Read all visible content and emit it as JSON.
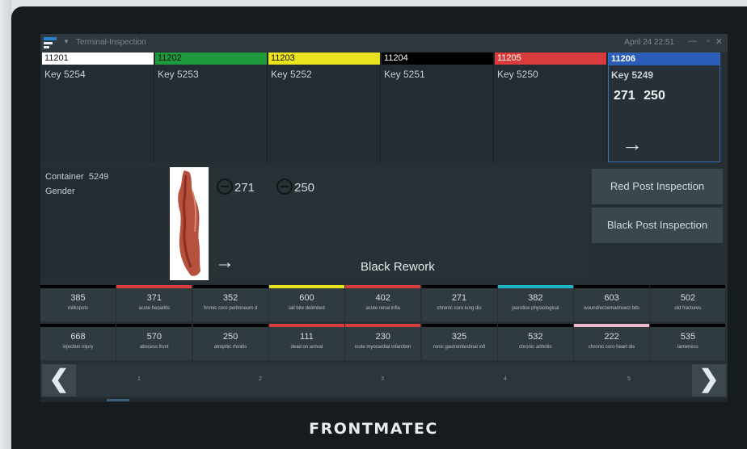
{
  "window": {
    "title": "Terminal-Inspection",
    "datetime": "April 24 22:51",
    "minimize": "—",
    "restore": "▫",
    "close": "✕"
  },
  "tiles": [
    {
      "id": "11201",
      "color": "#ffffff",
      "text_color": "#111111",
      "key": "Key 5254"
    },
    {
      "id": "11202",
      "color": "#1e9a3c",
      "text_color": "#111111",
      "key": "Key 5253"
    },
    {
      "id": "11203",
      "color": "#e9e21e",
      "text_color": "#111111",
      "key": "Key 5252"
    },
    {
      "id": "11204",
      "color": "#000000",
      "text_color": "#ffffff",
      "key": "Key 5251"
    },
    {
      "id": "11205",
      "color": "#d83c3c",
      "text_color": "#ffffff",
      "key": "Key 5250"
    },
    {
      "id": "11206",
      "color": "#2a5db7",
      "text_color": "#ffffff",
      "key": "Key 5249",
      "tag1": "271",
      "tag2": "250",
      "active": true
    }
  ],
  "info": {
    "container_label": "Container",
    "container_value": "5249",
    "gender_label": "Gender"
  },
  "center": {
    "tag1": "271",
    "tag2": "250",
    "label": "Black Rework"
  },
  "buttons": {
    "red_post": "Red Post Inspection",
    "black_post": "Black Post Inspection"
  },
  "findings_row1": [
    {
      "num": "385",
      "name": "milkspots",
      "color": "#000000"
    },
    {
      "num": "371",
      "name": "acute hepatitis",
      "color": "#d83c3c"
    },
    {
      "num": "352",
      "name": "hronic coro peritoneum d",
      "color": "#000000"
    },
    {
      "num": "600",
      "name": "tail bite delimited",
      "color": "#e9e21e"
    },
    {
      "num": "402",
      "name": "acute renal infla",
      "color": "#d83c3c"
    },
    {
      "num": "271",
      "name": "chronic coro lung dis",
      "color": "#000000"
    },
    {
      "num": "382",
      "name": "jaundice physiological",
      "color": "#1fb2c8"
    },
    {
      "num": "603",
      "name": "wound/eczema/insect bits",
      "color": "#000000"
    },
    {
      "num": "502",
      "name": "old fractures",
      "color": "#000000"
    }
  ],
  "findings_row2": [
    {
      "num": "668",
      "name": "injection injury",
      "color": "#000000"
    },
    {
      "num": "570",
      "name": "abscess front",
      "color": "#000000"
    },
    {
      "num": "250",
      "name": "atrophic rhinitis",
      "color": "#000000"
    },
    {
      "num": "111",
      "name": "dead on arrival",
      "color": "#d83c3c"
    },
    {
      "num": "230",
      "name": "icute myocardial infarction",
      "color": "#d83c3c"
    },
    {
      "num": "325",
      "name": "ronic gastrointestinal infl",
      "color": "#000000"
    },
    {
      "num": "532",
      "name": "chronic arthritis",
      "color": "#000000"
    },
    {
      "num": "222",
      "name": "chronic coro heart dis",
      "color": "#f0b7c8"
    },
    {
      "num": "535",
      "name": "lameness",
      "color": "#000000"
    }
  ],
  "pager": {
    "prev": "❮",
    "next": "❯",
    "pages": [
      "1",
      "2",
      "3",
      "4",
      "5"
    ]
  },
  "brand": "FRONTMATEC",
  "icons": {
    "app_logo": "frontmatec-logo-icon",
    "arrow": "arrow-right-icon",
    "minus": "minus-circle-icon"
  }
}
